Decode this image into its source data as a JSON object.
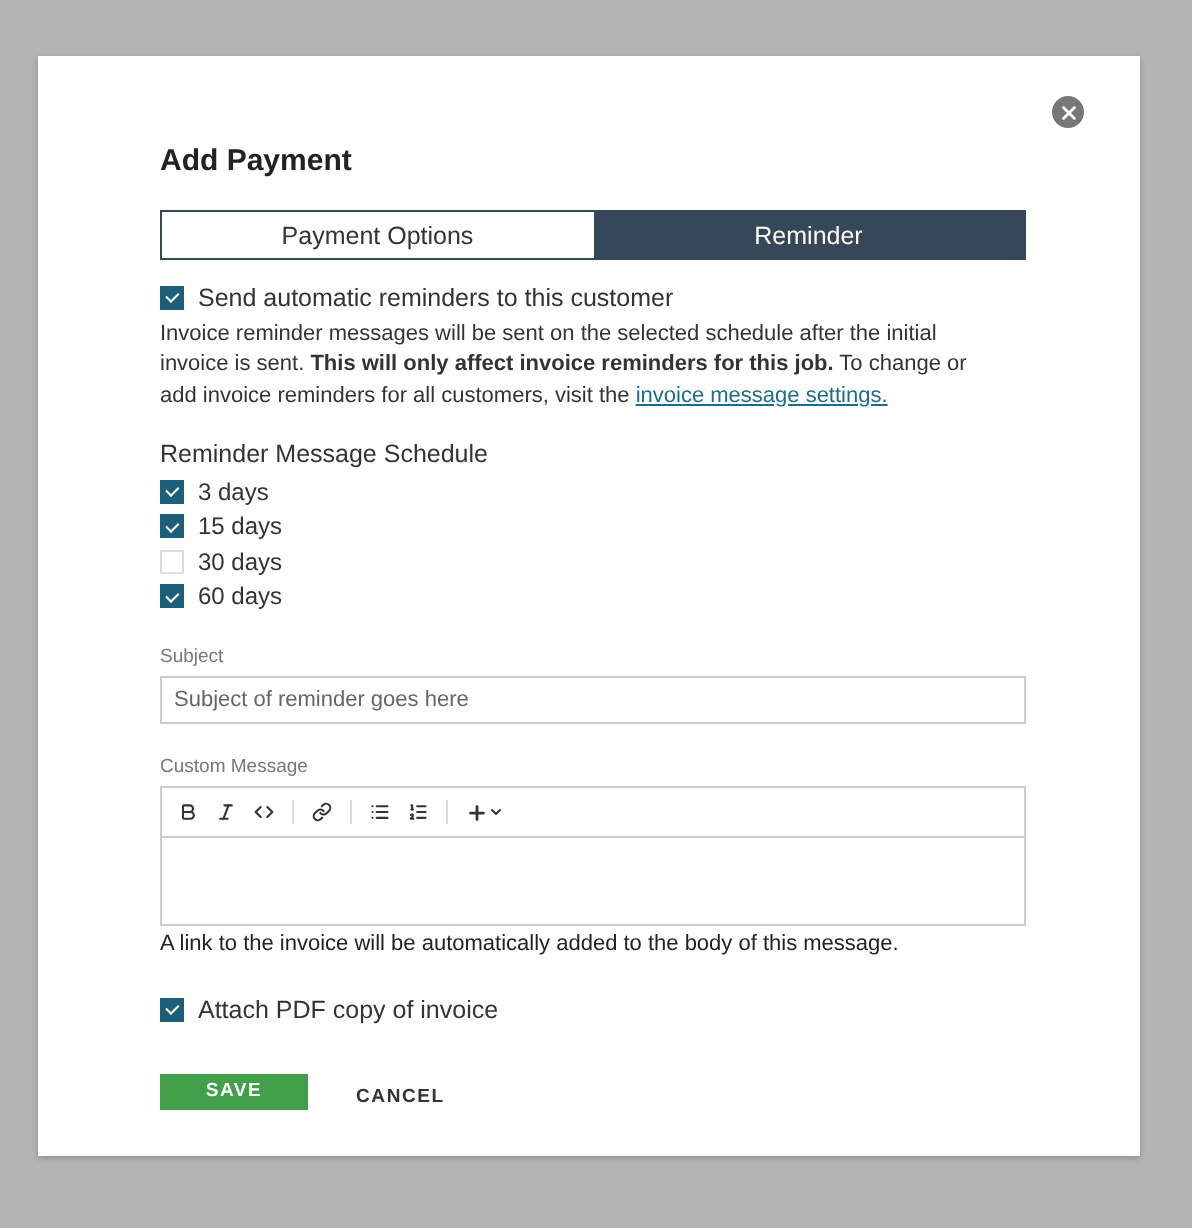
{
  "dialog": {
    "title": "Add Payment"
  },
  "tabs": [
    {
      "label": "Payment Options",
      "selected": false
    },
    {
      "label": "Reminder",
      "selected": true
    }
  ],
  "auto_reminders": {
    "label": "Send automatic reminders to this customer",
    "checked": true
  },
  "description": {
    "text": "Invoice reminder messages will be sent on the selected schedule after the initial invoice is sent. **This will only affect invoice reminders for this job.** To change or add invoice reminders for all customers, visit the",
    "link": "invoice message settings."
  },
  "schedule": {
    "title": "Reminder Message Schedule",
    "options": [
      {
        "label": "3 days",
        "checked": true
      },
      {
        "label": "15 days",
        "checked": true
      },
      {
        "label": "30 days",
        "checked": false
      },
      {
        "label": "60 days",
        "checked": true
      }
    ]
  },
  "subject": {
    "label": "Subject",
    "placeholder": "Subject of reminder goes here"
  },
  "custom_message": {
    "label": "Custom Message",
    "note": "A link to the invoice will be automatically added to the body of this message."
  },
  "attach_pdf": {
    "label": "Attach PDF copy of invoice",
    "checked": true
  },
  "buttons": {
    "save": "SAVE",
    "cancel": "CANCEL"
  }
}
